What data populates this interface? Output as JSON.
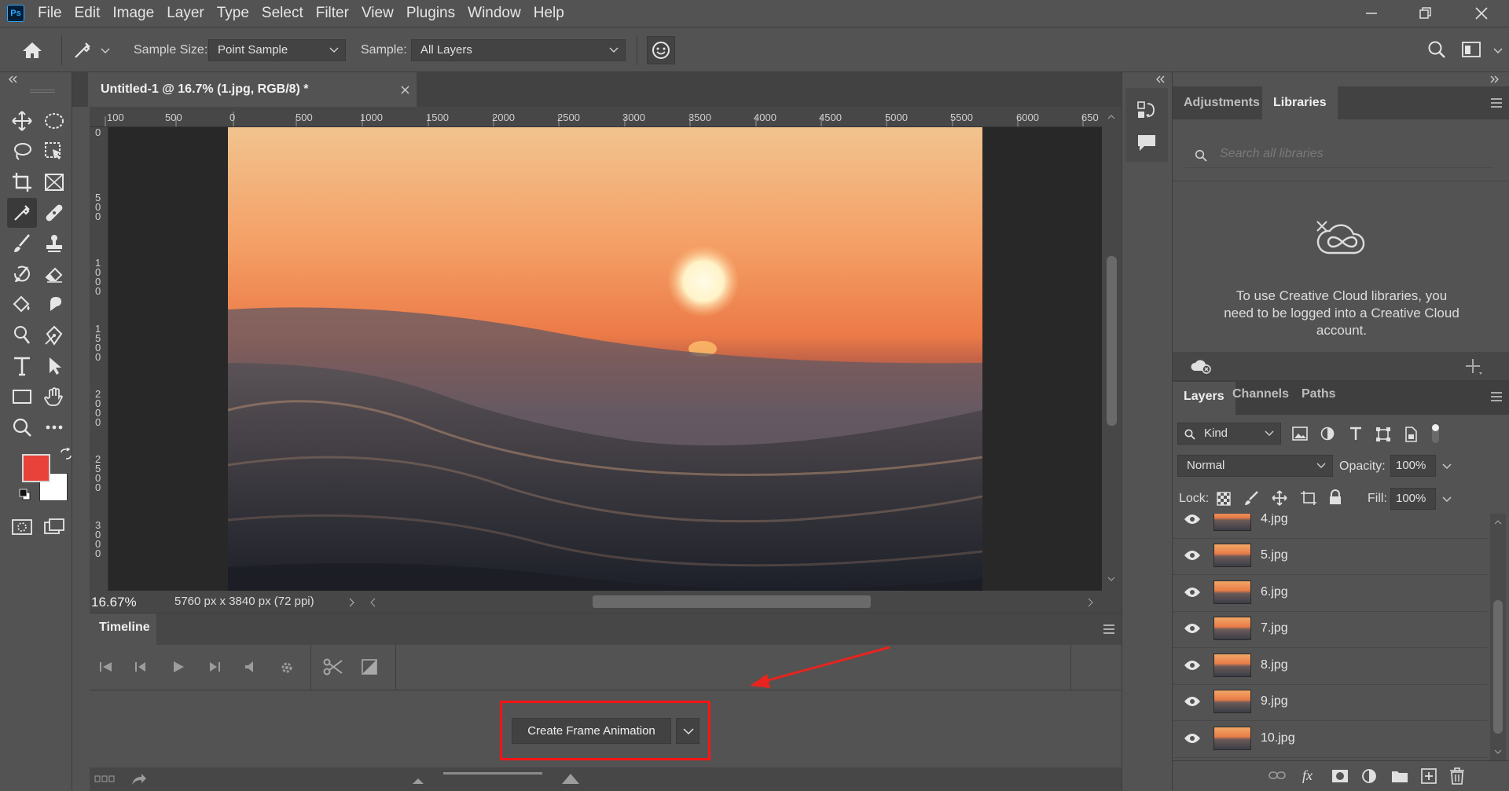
{
  "menubar": {
    "logo": "Ps",
    "items": [
      "File",
      "Edit",
      "Image",
      "Layer",
      "Type",
      "Select",
      "Filter",
      "View",
      "Plugins",
      "Window",
      "Help"
    ]
  },
  "options": {
    "sample_size_label": "Sample Size:",
    "sample_size_value": "Point Sample",
    "sample_label": "Sample:",
    "sample_value": "All Layers"
  },
  "document": {
    "tab_title": "Untitled-1 @ 16.7% (1.jpg, RGB/8) *",
    "ruler_h": [
      "100",
      "500",
      "0",
      "500",
      "1000",
      "1500",
      "2000",
      "2500",
      "3000",
      "3500",
      "4000",
      "4500",
      "5000",
      "5500",
      "6000",
      "650"
    ],
    "ruler_v": [
      "0",
      "5\n0\n0",
      "1\n0\n0\n0",
      "1\n5\n0\n0",
      "2\n0\n0\n0",
      "2\n5\n0\n0",
      "3\n0\n0\n0"
    ],
    "zoom": "16.67%",
    "dimensions": "5760 px x 3840 px (72 ppi)"
  },
  "timeline": {
    "tab": "Timeline",
    "create_button": "Create Frame Animation"
  },
  "libraries": {
    "tabs": [
      "Adjustments",
      "Libraries"
    ],
    "search_placeholder": "Search all libraries",
    "message": "To use Creative Cloud libraries, you need to be logged into a Creative Cloud account."
  },
  "layers": {
    "tabs": [
      "Layers",
      "Channels",
      "Paths"
    ],
    "filter_kind": "Kind",
    "blend_mode": "Normal",
    "opacity_label": "Opacity:",
    "opacity_value": "100%",
    "lock_label": "Lock:",
    "fill_label": "Fill:",
    "fill_value": "100%",
    "items": [
      {
        "name": "4.jpg"
      },
      {
        "name": "5.jpg"
      },
      {
        "name": "6.jpg"
      },
      {
        "name": "7.jpg"
      },
      {
        "name": "8.jpg"
      },
      {
        "name": "9.jpg"
      },
      {
        "name": "10.jpg"
      }
    ]
  },
  "colors": {
    "foreground": "#e8423a",
    "background": "#ffffff",
    "highlight": "#ff1414",
    "arrow": "#e8241e"
  }
}
